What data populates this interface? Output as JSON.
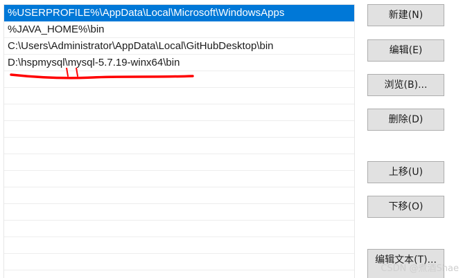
{
  "path_list": {
    "entries": [
      "%USERPROFILE%\\AppData\\Local\\Microsoft\\WindowsApps",
      "%JAVA_HOME%\\bin",
      "C:\\Users\\Administrator\\AppData\\Local\\GitHubDesktop\\bin",
      "D:\\hspmysql\\mysql-5.7.19-winx64\\bin",
      "",
      "",
      "",
      "",
      "",
      "",
      "",
      "",
      "",
      "",
      "",
      ""
    ],
    "selected_index": 0
  },
  "buttons": {
    "new_label": "新建(N)",
    "edit_label": "编辑(E)",
    "browse_label": "浏览(B)...",
    "delete_label": "删除(D)",
    "move_up_label": "上移(U)",
    "move_down_label": "下移(O)",
    "edit_text_label": "编辑文本(T)..."
  },
  "watermark": "CSDN @煮酒Shae",
  "colors": {
    "selection": "#0078d7",
    "annotation": "#ff0000"
  }
}
